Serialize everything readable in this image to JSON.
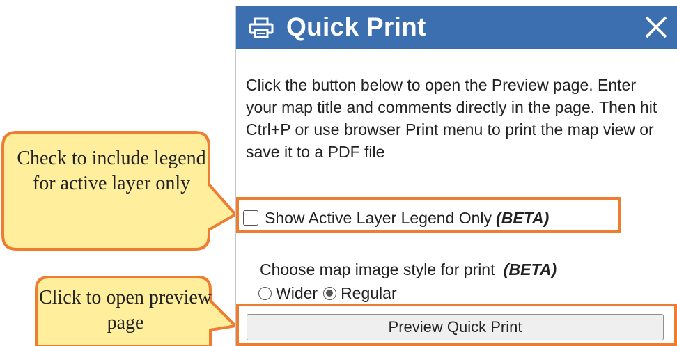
{
  "dialog": {
    "title": "Quick Print",
    "icon": "printer-icon",
    "close_icon": "close-icon",
    "header_color": "#3b6fb0",
    "description": "Click the button below to open the Preview page. Enter your map title and comments directly in the page. Then hit Ctrl+P or use browser Print menu to print the map view or save it to a PDF file",
    "legend_option": {
      "label": "Show Active Layer Legend Only",
      "beta": "(BETA)",
      "checked": false
    },
    "image_style": {
      "label": "Choose map image style for print",
      "beta": "(BETA)",
      "options": [
        {
          "label": "Wider",
          "selected": false
        },
        {
          "label": "Regular",
          "selected": true
        }
      ]
    },
    "preview_button": "Preview Quick Print"
  },
  "callouts": {
    "legend": "Check to include legend for active layer only",
    "preview": "Click to open preview page",
    "fill_color": "#ffef9c",
    "border_color": "#ed7d31"
  }
}
